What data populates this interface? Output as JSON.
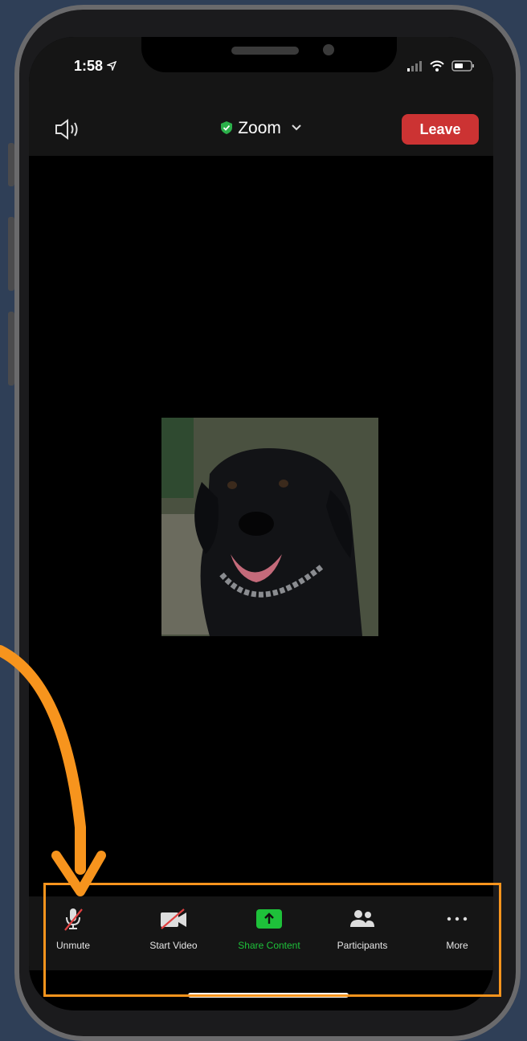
{
  "status_bar": {
    "time": "1:58"
  },
  "meeting": {
    "title": "Zoom",
    "leave_label": "Leave"
  },
  "toolbar": {
    "items": [
      {
        "label": "Unmute"
      },
      {
        "label": "Start Video"
      },
      {
        "label": "Share Content"
      },
      {
        "label": "Participants"
      },
      {
        "label": "More"
      }
    ]
  },
  "colors": {
    "leave": "#cc3333",
    "share": "#1ec13a",
    "highlight": "#f7941d",
    "background": "#2f3f57"
  },
  "icons": [
    "location-arrow-icon",
    "signal-icon",
    "wifi-icon",
    "battery-icon",
    "speaker-icon",
    "shield-check-icon",
    "chevron-down-icon",
    "microphone-muted-icon",
    "video-muted-icon",
    "share-up-arrow-icon",
    "participants-icon",
    "more-dots-icon"
  ]
}
